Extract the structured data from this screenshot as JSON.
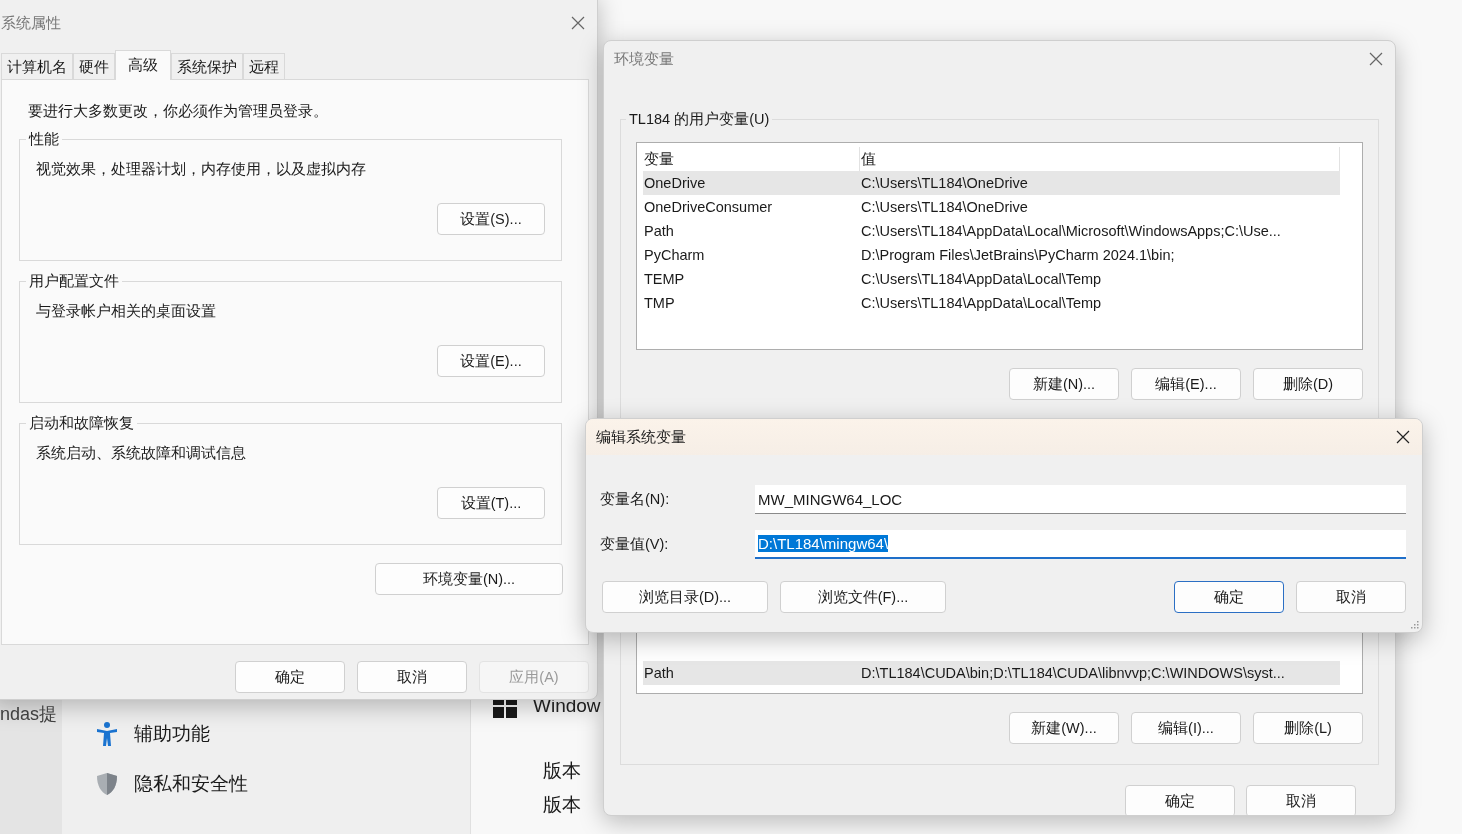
{
  "background": {
    "side_text": "ndas提",
    "nav_items": [
      {
        "label": "辅助功能",
        "kind": "accessibility"
      },
      {
        "label": "隐私和安全性",
        "kind": "shield"
      }
    ],
    "product": "Window",
    "info_labels": [
      "版本",
      "版本"
    ]
  },
  "system_properties": {
    "title": "系统属性",
    "tabs": [
      {
        "label": "计算机名",
        "selected": false
      },
      {
        "label": "硬件",
        "selected": false
      },
      {
        "label": "高级",
        "selected": true
      },
      {
        "label": "系统保护",
        "selected": false
      },
      {
        "label": "远程",
        "selected": false
      }
    ],
    "notice": "要进行大多数更改，你必须作为管理员登录。",
    "groups": [
      {
        "title": "性能",
        "description": "视觉效果，处理器计划，内存使用，以及虚拟内存",
        "button": "设置(S)..."
      },
      {
        "title": "用户配置文件",
        "description": "与登录帐户相关的桌面设置",
        "button": "设置(E)..."
      },
      {
        "title": "启动和故障恢复",
        "description": "系统启动、系统故障和调试信息",
        "button": "设置(T)..."
      }
    ],
    "env_button": "环境变量(N)...",
    "buttons": [
      {
        "label": "确定",
        "disabled": false
      },
      {
        "label": "取消",
        "disabled": false
      },
      {
        "label": "应用(A)",
        "disabled": true
      }
    ]
  },
  "environment_variables": {
    "title": "环境变量",
    "user_group": {
      "title": "TL184 的用户变量(U)",
      "columns": [
        "变量",
        "值"
      ],
      "rows": [
        {
          "name": "OneDrive",
          "value": "C:\\Users\\TL184\\OneDrive",
          "selected": true
        },
        {
          "name": "OneDriveConsumer",
          "value": "C:\\Users\\TL184\\OneDrive",
          "selected": false
        },
        {
          "name": "Path",
          "value": "C:\\Users\\TL184\\AppData\\Local\\Microsoft\\WindowsApps;C:\\Use...",
          "selected": false
        },
        {
          "name": "PyCharm",
          "value": "D:\\Program Files\\JetBrains\\PyCharm 2024.1\\bin;",
          "selected": false
        },
        {
          "name": "TEMP",
          "value": "C:\\Users\\TL184\\AppData\\Local\\Temp",
          "selected": false
        },
        {
          "name": "TMP",
          "value": "C:\\Users\\TL184\\AppData\\Local\\Temp",
          "selected": false
        }
      ],
      "buttons": [
        "新建(N)...",
        "编辑(E)...",
        "删除(D)"
      ]
    },
    "system_group": {
      "rows": [
        {
          "name": "Path",
          "value": "D:\\TL184\\CUDA\\bin;D:\\TL184\\CUDA\\libnvvp;C:\\WINDOWS\\syst...",
          "selected": true
        }
      ],
      "buttons": [
        "新建(W)...",
        "编辑(I)...",
        "删除(L)"
      ]
    },
    "buttons": [
      "确定",
      "取消"
    ]
  },
  "edit_dialog": {
    "title": "编辑系统变量",
    "fields": [
      {
        "label": "变量名(N):",
        "value": "MW_MINGW64_LOC",
        "focused": false,
        "text_selected": false
      },
      {
        "label": "变量值(V):",
        "value": "D:\\TL184\\mingw64\\",
        "focused": true,
        "text_selected": true
      }
    ],
    "left_buttons": [
      "浏览目录(D)...",
      "浏览文件(F)..."
    ],
    "buttons": [
      {
        "label": "确定",
        "default": true
      },
      {
        "label": "取消",
        "default": false
      }
    ]
  }
}
